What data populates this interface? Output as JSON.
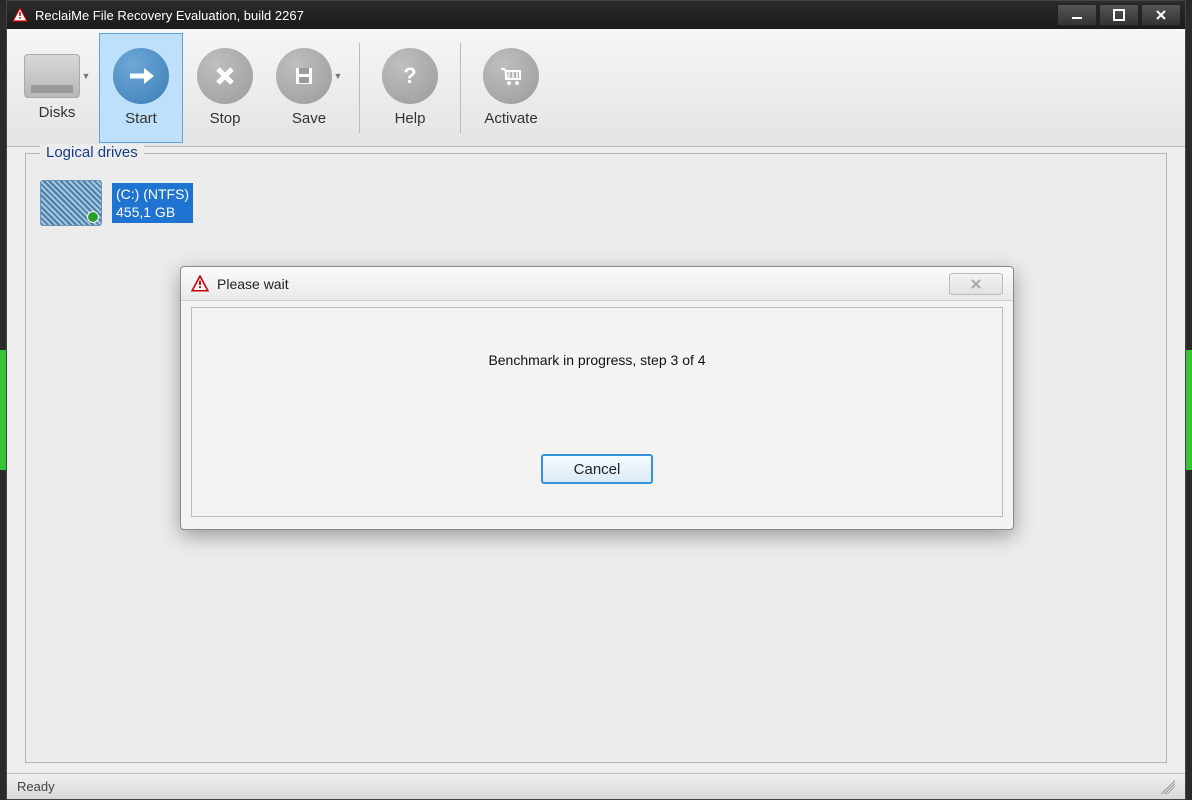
{
  "window": {
    "title": "ReclaiMe File Recovery Evaluation, build 2267"
  },
  "toolbar": {
    "disks": "Disks",
    "start": "Start",
    "stop": "Stop",
    "save": "Save",
    "help": "Help",
    "activate": "Activate"
  },
  "panel": {
    "legend": "Logical drives",
    "drive": {
      "name": "(C:) (NTFS)",
      "size": "455,1 GB"
    }
  },
  "dialog": {
    "title": "Please wait",
    "message": "Benchmark in progress, step 3 of 4",
    "cancel": "Cancel"
  },
  "status": {
    "text": "Ready"
  }
}
